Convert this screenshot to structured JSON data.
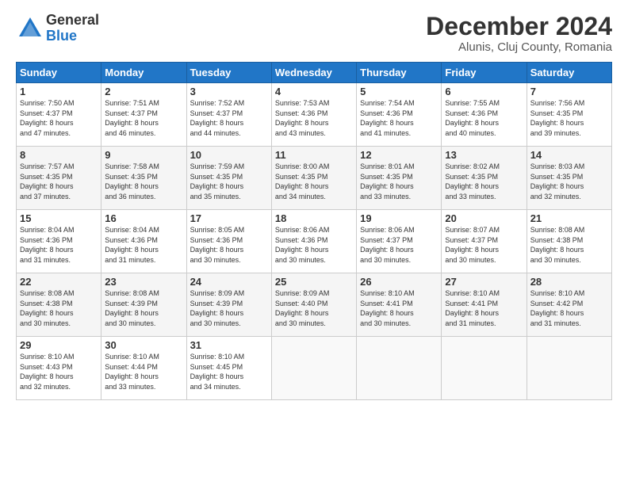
{
  "logo": {
    "general": "General",
    "blue": "Blue"
  },
  "title": "December 2024",
  "location": "Alunis, Cluj County, Romania",
  "days_of_week": [
    "Sunday",
    "Monday",
    "Tuesday",
    "Wednesday",
    "Thursday",
    "Friday",
    "Saturday"
  ],
  "weeks": [
    [
      {
        "day": "1",
        "sunrise": "7:50 AM",
        "sunset": "4:37 PM",
        "daylight": "8 hours and 47 minutes."
      },
      {
        "day": "2",
        "sunrise": "7:51 AM",
        "sunset": "4:37 PM",
        "daylight": "8 hours and 46 minutes."
      },
      {
        "day": "3",
        "sunrise": "7:52 AM",
        "sunset": "4:37 PM",
        "daylight": "8 hours and 44 minutes."
      },
      {
        "day": "4",
        "sunrise": "7:53 AM",
        "sunset": "4:36 PM",
        "daylight": "8 hours and 43 minutes."
      },
      {
        "day": "5",
        "sunrise": "7:54 AM",
        "sunset": "4:36 PM",
        "daylight": "8 hours and 41 minutes."
      },
      {
        "day": "6",
        "sunrise": "7:55 AM",
        "sunset": "4:36 PM",
        "daylight": "8 hours and 40 minutes."
      },
      {
        "day": "7",
        "sunrise": "7:56 AM",
        "sunset": "4:35 PM",
        "daylight": "8 hours and 39 minutes."
      }
    ],
    [
      {
        "day": "8",
        "sunrise": "7:57 AM",
        "sunset": "4:35 PM",
        "daylight": "8 hours and 37 minutes."
      },
      {
        "day": "9",
        "sunrise": "7:58 AM",
        "sunset": "4:35 PM",
        "daylight": "8 hours and 36 minutes."
      },
      {
        "day": "10",
        "sunrise": "7:59 AM",
        "sunset": "4:35 PM",
        "daylight": "8 hours and 35 minutes."
      },
      {
        "day": "11",
        "sunrise": "8:00 AM",
        "sunset": "4:35 PM",
        "daylight": "8 hours and 34 minutes."
      },
      {
        "day": "12",
        "sunrise": "8:01 AM",
        "sunset": "4:35 PM",
        "daylight": "8 hours and 33 minutes."
      },
      {
        "day": "13",
        "sunrise": "8:02 AM",
        "sunset": "4:35 PM",
        "daylight": "8 hours and 33 minutes."
      },
      {
        "day": "14",
        "sunrise": "8:03 AM",
        "sunset": "4:35 PM",
        "daylight": "8 hours and 32 minutes."
      }
    ],
    [
      {
        "day": "15",
        "sunrise": "8:04 AM",
        "sunset": "4:36 PM",
        "daylight": "8 hours and 31 minutes."
      },
      {
        "day": "16",
        "sunrise": "8:04 AM",
        "sunset": "4:36 PM",
        "daylight": "8 hours and 31 minutes."
      },
      {
        "day": "17",
        "sunrise": "8:05 AM",
        "sunset": "4:36 PM",
        "daylight": "8 hours and 30 minutes."
      },
      {
        "day": "18",
        "sunrise": "8:06 AM",
        "sunset": "4:36 PM",
        "daylight": "8 hours and 30 minutes."
      },
      {
        "day": "19",
        "sunrise": "8:06 AM",
        "sunset": "4:37 PM",
        "daylight": "8 hours and 30 minutes."
      },
      {
        "day": "20",
        "sunrise": "8:07 AM",
        "sunset": "4:37 PM",
        "daylight": "8 hours and 30 minutes."
      },
      {
        "day": "21",
        "sunrise": "8:08 AM",
        "sunset": "4:38 PM",
        "daylight": "8 hours and 30 minutes."
      }
    ],
    [
      {
        "day": "22",
        "sunrise": "8:08 AM",
        "sunset": "4:38 PM",
        "daylight": "8 hours and 30 minutes."
      },
      {
        "day": "23",
        "sunrise": "8:08 AM",
        "sunset": "4:39 PM",
        "daylight": "8 hours and 30 minutes."
      },
      {
        "day": "24",
        "sunrise": "8:09 AM",
        "sunset": "4:39 PM",
        "daylight": "8 hours and 30 minutes."
      },
      {
        "day": "25",
        "sunrise": "8:09 AM",
        "sunset": "4:40 PM",
        "daylight": "8 hours and 30 minutes."
      },
      {
        "day": "26",
        "sunrise": "8:10 AM",
        "sunset": "4:41 PM",
        "daylight": "8 hours and 30 minutes."
      },
      {
        "day": "27",
        "sunrise": "8:10 AM",
        "sunset": "4:41 PM",
        "daylight": "8 hours and 31 minutes."
      },
      {
        "day": "28",
        "sunrise": "8:10 AM",
        "sunset": "4:42 PM",
        "daylight": "8 hours and 31 minutes."
      }
    ],
    [
      {
        "day": "29",
        "sunrise": "8:10 AM",
        "sunset": "4:43 PM",
        "daylight": "8 hours and 32 minutes."
      },
      {
        "day": "30",
        "sunrise": "8:10 AM",
        "sunset": "4:44 PM",
        "daylight": "8 hours and 33 minutes."
      },
      {
        "day": "31",
        "sunrise": "8:10 AM",
        "sunset": "4:45 PM",
        "daylight": "8 hours and 34 minutes."
      },
      null,
      null,
      null,
      null
    ]
  ],
  "labels": {
    "sunrise": "Sunrise:",
    "sunset": "Sunset:",
    "daylight": "Daylight:"
  }
}
